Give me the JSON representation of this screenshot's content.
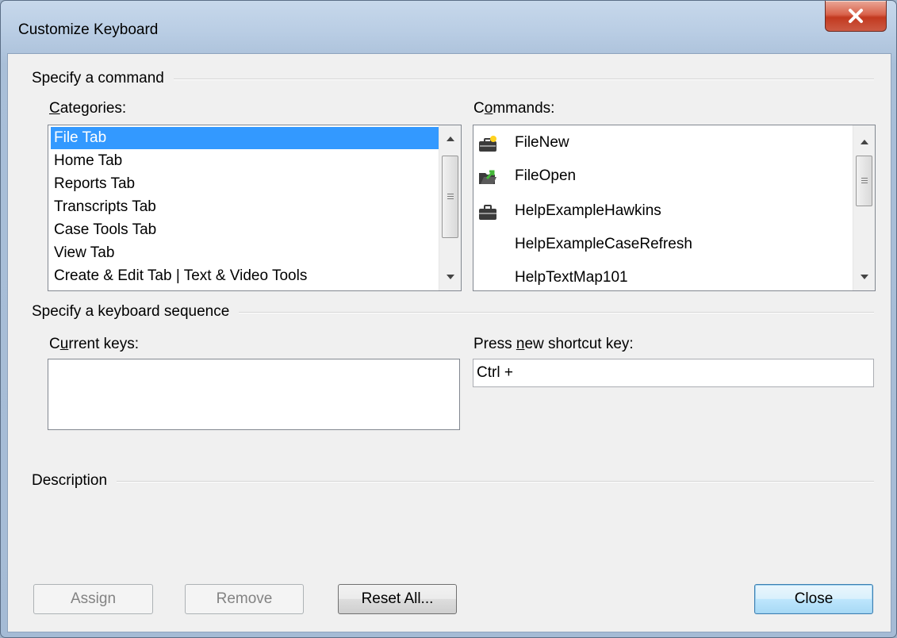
{
  "window": {
    "title": "Customize Keyboard",
    "close_glyph": "close-icon"
  },
  "command_group": {
    "title": "Specify a command",
    "categories": {
      "label_underline": "C",
      "label_rest": "ategories:",
      "items": [
        "File Tab",
        "Home Tab",
        "Reports Tab",
        "Transcripts Tab",
        "Case Tools Tab",
        "View Tab",
        "Create & Edit Tab | Text & Video Tools"
      ],
      "selected": "File Tab"
    },
    "commands": {
      "label_first": "C",
      "label_underline": "o",
      "label_rest": "mmands:",
      "items": [
        {
          "label": "FileNew",
          "icon": "file-new-icon"
        },
        {
          "label": "FileOpen",
          "icon": "file-open-icon"
        },
        {
          "label": "HelpExampleHawkins",
          "icon": "briefcase-icon"
        },
        {
          "label": "HelpExampleCaseRefresh",
          "icon": ""
        },
        {
          "label": "HelpTextMap101",
          "icon": ""
        }
      ]
    }
  },
  "keyboard_group": {
    "title": "Specify a keyboard sequence",
    "current_keys": {
      "label_first": "C",
      "label_underline": "u",
      "label_rest": "rrent keys:"
    },
    "new_shortcut": {
      "label_first": "Press ",
      "label_underline": "n",
      "label_rest": "ew shortcut key:",
      "value": "Ctrl + "
    }
  },
  "description_group": {
    "title": "Description"
  },
  "buttons": {
    "assign": "Assign",
    "remove": "Remove",
    "reset_all": "Reset All...",
    "close": "Close"
  },
  "colors": {
    "selection": "#3399ff",
    "dialog_bg": "#f0f0f0",
    "close_button_red": "#c2391f"
  }
}
